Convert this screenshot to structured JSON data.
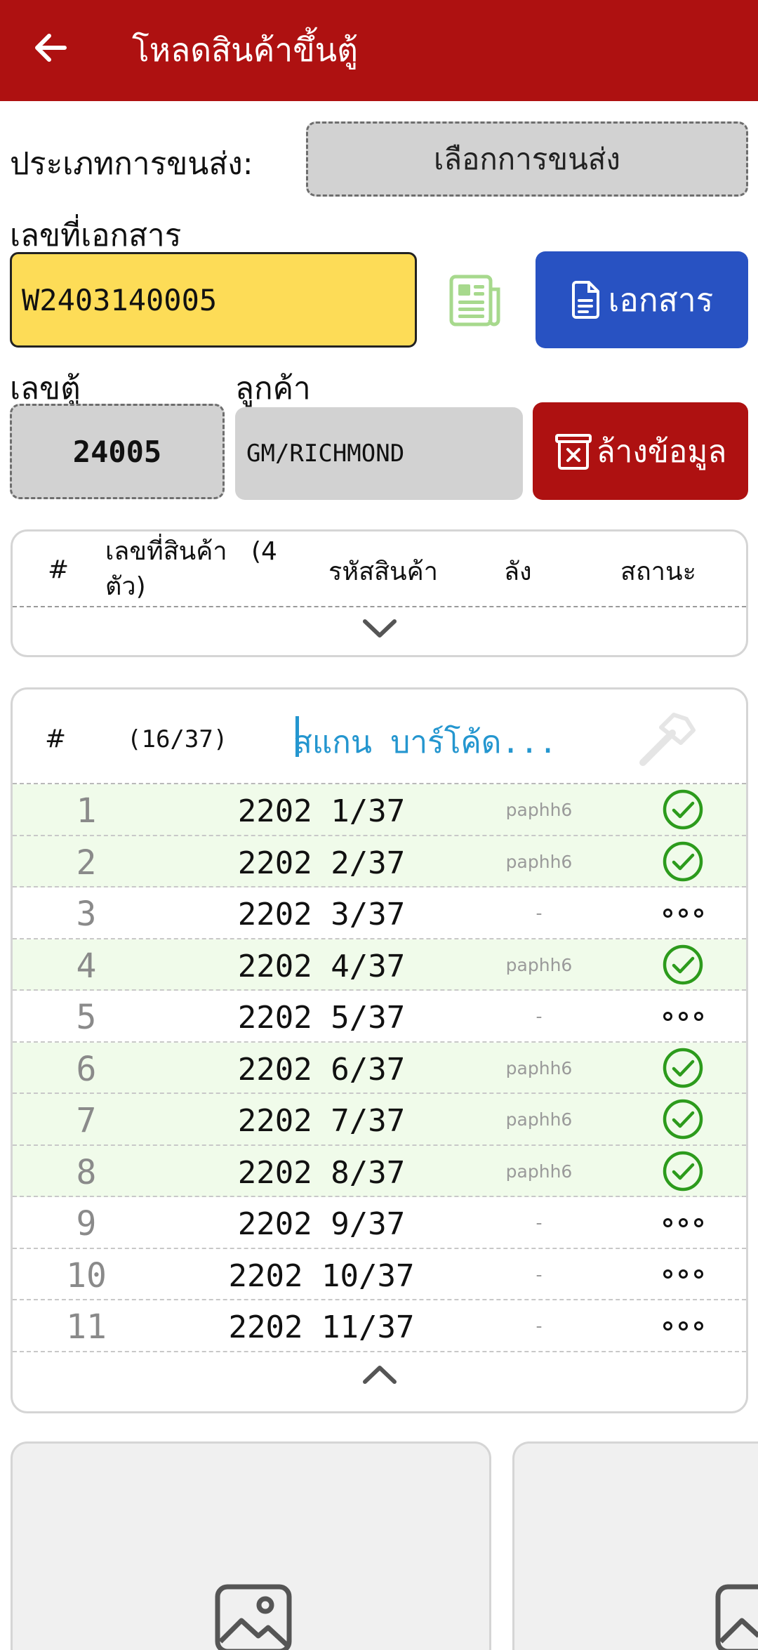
{
  "appbar": {
    "title": "โหลดสินค้าขึ้นตู้",
    "back_icon": "arrow-left-icon"
  },
  "form": {
    "shipping_label": "ประเภทการขนส่ง:",
    "shipping_value": "เลือกการขนส่ง",
    "doc_label": "เลขที่เอกสาร",
    "doc_value": "W2403140005",
    "doc_button": "เอกสาร",
    "container_label": "เลขตู้",
    "container_value": "24005",
    "customer_label": "ลูกค้า",
    "customer_value": "GM/RICHMOND",
    "clear_button": "ล้างข้อมูล"
  },
  "product_table": {
    "col_num": "#",
    "col_product_no": "เลขที่สินค้า",
    "count": "(4",
    "count_suffix": "ตัว)",
    "col_product_code": "รหัสสินค้า",
    "col_box": "ลัง",
    "col_status": "สถานะ"
  },
  "scan": {
    "col_num": "#",
    "progress": "(16/37)",
    "placeholder": "สแกน บาร์โค้ด...",
    "scanned": 16,
    "total": 37,
    "rows": [
      {
        "num": "1",
        "code": "2202 1/37",
        "box": "paphh6",
        "status": "done"
      },
      {
        "num": "2",
        "code": "2202 2/37",
        "box": "paphh6",
        "status": "done"
      },
      {
        "num": "3",
        "code": "2202 3/37",
        "box": "-",
        "status": "pending"
      },
      {
        "num": "4",
        "code": "2202 4/37",
        "box": "paphh6",
        "status": "done"
      },
      {
        "num": "5",
        "code": "2202 5/37",
        "box": "-",
        "status": "pending"
      },
      {
        "num": "6",
        "code": "2202 6/37",
        "box": "paphh6",
        "status": "done"
      },
      {
        "num": "7",
        "code": "2202 7/37",
        "box": "paphh6",
        "status": "done"
      },
      {
        "num": "8",
        "code": "2202 8/37",
        "box": "paphh6",
        "status": "done"
      },
      {
        "num": "9",
        "code": "2202 9/37",
        "box": "-",
        "status": "pending"
      },
      {
        "num": "10",
        "code": "2202 10/37",
        "box": "-",
        "status": "pending"
      },
      {
        "num": "11",
        "code": "2202 11/37",
        "box": "-",
        "status": "pending"
      }
    ]
  },
  "colors": {
    "appbar": "#ae1111",
    "doc_button": "#2852c2",
    "clear_button": "#ae1111",
    "doc_input": "#fddc57",
    "done_row": "#f0fbea",
    "check": "#2c9b1c",
    "scan_text": "#2496cf"
  },
  "images": {
    "icon": "image-placeholder-icon"
  }
}
